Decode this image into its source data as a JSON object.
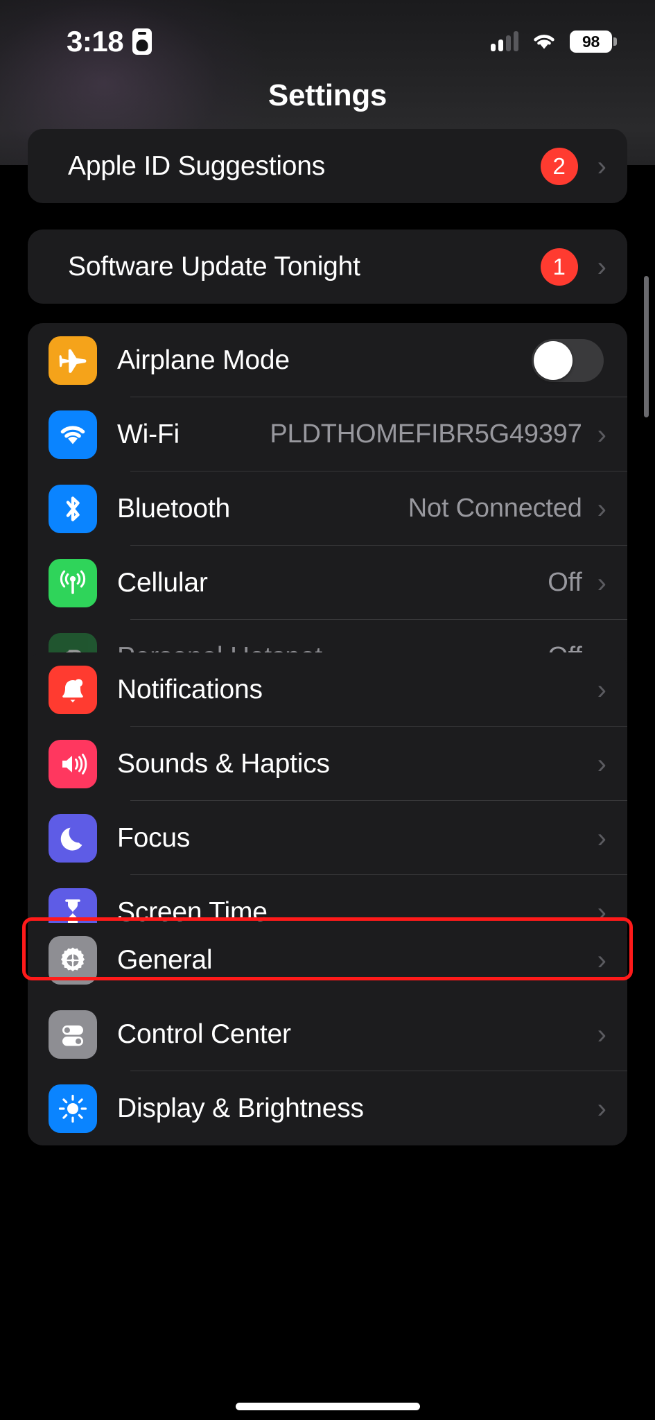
{
  "statusbar": {
    "time": "3:18",
    "badge_icon": "id-card-icon",
    "cellular_icon": "cellular-bars-icon",
    "cellular_bars_filled": 2,
    "cellular_bars_total": 4,
    "wifi_icon": "wifi-icon",
    "battery_level": "98",
    "battery_icon": "battery-icon"
  },
  "nav": {
    "title": "Settings"
  },
  "groups": [
    {
      "id": "apple-id-suggestions",
      "rows": [
        {
          "label": "Apple ID Suggestions",
          "badge": "2",
          "chevron": "›",
          "icon": null
        }
      ]
    },
    {
      "id": "software-update",
      "rows": [
        {
          "label": "Software Update Tonight",
          "badge": "1",
          "chevron": "›",
          "icon": null
        }
      ]
    },
    {
      "id": "connectivity",
      "rows": [
        {
          "label": "Airplane Mode",
          "value": "",
          "toggle": "off",
          "icon": "airplane-icon",
          "icon_color": "#f5a31a"
        },
        {
          "label": "Wi-Fi",
          "value": "PLDTHOMEFIBR5G49397",
          "chevron": "›",
          "icon": "wifi-icon",
          "icon_color": "#0a84ff"
        },
        {
          "label": "Bluetooth",
          "value": "Not Connected",
          "chevron": "›",
          "icon": "bluetooth-icon",
          "icon_color": "#0a84ff"
        },
        {
          "label": "Cellular",
          "value": "Off",
          "chevron": "›",
          "icon": "cellular-antenna-icon",
          "icon_color": "#2fd45a"
        },
        {
          "label": "Personal Hotspot",
          "value": "Off",
          "chevron": "›",
          "icon": "hotspot-link-icon",
          "icon_color": "#25863f",
          "disabled": true
        }
      ]
    },
    {
      "id": "notifications",
      "rows": [
        {
          "label": "Notifications",
          "chevron": "›",
          "icon": "bell-icon",
          "icon_color": "#ff3b30"
        },
        {
          "label": "Sounds & Haptics",
          "chevron": "›",
          "icon": "speaker-icon",
          "icon_color": "#ff375f"
        },
        {
          "label": "Focus",
          "chevron": "›",
          "icon": "moon-icon",
          "icon_color": "#5e5ce6"
        },
        {
          "label": "Screen Time",
          "chevron": "›",
          "icon": "hourglass-icon",
          "icon_color": "#5e5ce6"
        }
      ]
    },
    {
      "id": "general",
      "rows": [
        {
          "label": "General",
          "chevron": "›",
          "icon": "gear-icon",
          "icon_color": "#8e8e93",
          "highlighted": true
        },
        {
          "label": "Control Center",
          "chevron": "›",
          "icon": "control-center-icon",
          "icon_color": "#8e8e93"
        },
        {
          "label": "Display & Brightness",
          "chevron": "›",
          "icon": "brightness-sun-icon",
          "icon_color": "#0a84ff"
        }
      ]
    }
  ],
  "annotation": {
    "color": "#ff1a1a",
    "target": "General"
  }
}
